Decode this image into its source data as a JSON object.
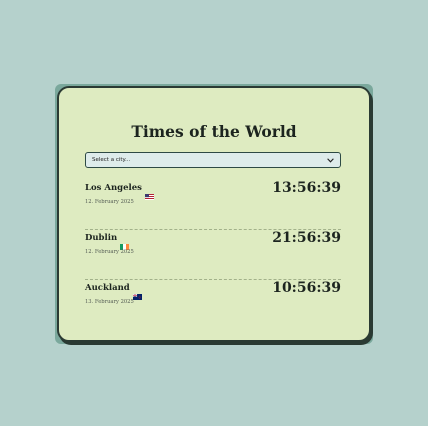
{
  "app": {
    "title": "Times of the World"
  },
  "selector": {
    "placeholder": "Select a city..."
  },
  "clocks": [
    {
      "city": "Los Angeles",
      "flag": "us-flag-icon",
      "date": "12. February 2025",
      "time": "13:56:39"
    },
    {
      "city": "Dublin",
      "flag": "ie-flag-icon",
      "date": "12. February 2025",
      "time": "21:56:39"
    },
    {
      "city": "Auckland",
      "flag": "nz-flag-icon",
      "date": "13. February 2025",
      "time": "10:56:39"
    }
  ],
  "colors": {
    "page_background": "#b5d1cc",
    "card_background": "#deebc1",
    "card_border": "#2a3a33",
    "select_background": "#deeceb",
    "text": "#1c241f"
  }
}
